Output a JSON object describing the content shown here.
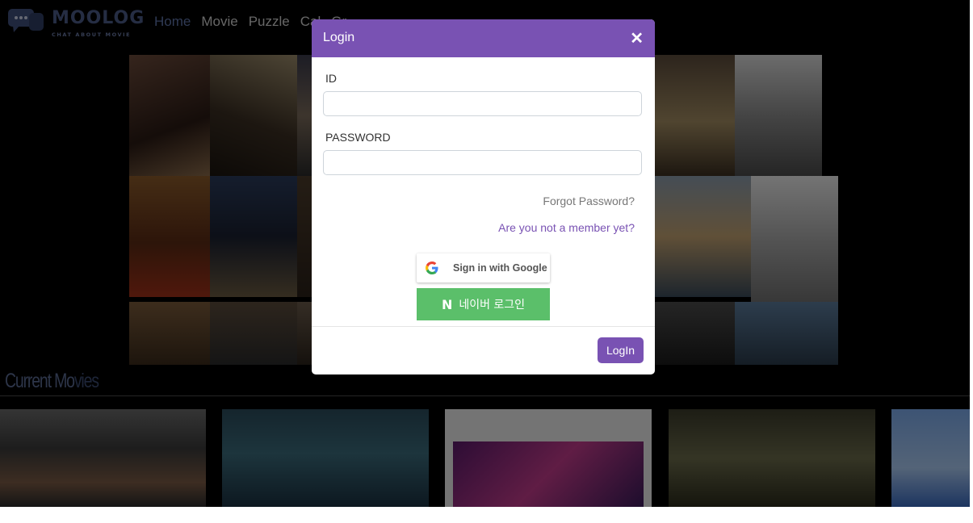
{
  "nav": {
    "logo_text": "MOOLOG",
    "logo_tagline": "CHAT ABOUT MOVIE",
    "links": [
      "Home",
      "Movie",
      "Puzzle",
      "Cal",
      "Gr"
    ]
  },
  "section": {
    "title_part1": "Current Mo",
    "title_part2": "vies"
  },
  "modal": {
    "title": "Login",
    "close_symbol": "✕",
    "id_label": "ID",
    "id_value": "",
    "password_label": "PASSWORD",
    "password_value": "",
    "forgot_link": "Forgot Password?",
    "signup_link": "Are you not a member yet?",
    "google_label": "Sign in with Google",
    "naver_icon_text": "N",
    "naver_label": "네이버 로그인",
    "submit_label": "LogIn"
  },
  "colors": {
    "accent": "#7952b3",
    "naver_green": "#5bbf6a",
    "nav_active": "#5f74a8"
  },
  "icons": {
    "logo": "chat-bubble-icon",
    "close": "close-icon",
    "google": "google-g-icon",
    "naver": "naver-n-icon"
  }
}
